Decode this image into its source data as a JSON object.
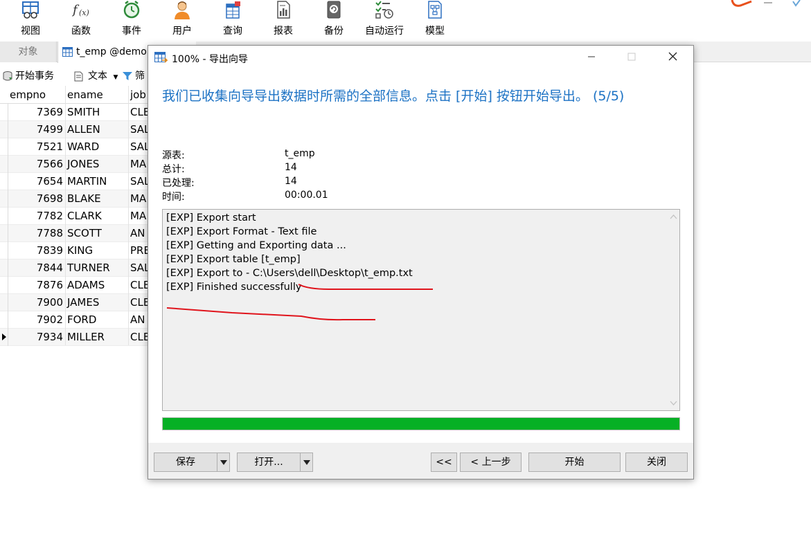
{
  "toolbar": {
    "items": [
      {
        "label": "视图",
        "icon": "view-grid-icon"
      },
      {
        "label": "函数",
        "icon": "function-icon"
      },
      {
        "label": "事件",
        "icon": "alarm-clock-icon"
      },
      {
        "label": "用户",
        "icon": "user-icon"
      },
      {
        "label": "查询",
        "icon": "query-icon"
      },
      {
        "label": "报表",
        "icon": "report-icon"
      },
      {
        "label": "备份",
        "icon": "backup-icon"
      },
      {
        "label": "自动运行",
        "icon": "auto-run-icon"
      },
      {
        "label": "模型",
        "icon": "model-icon"
      }
    ]
  },
  "tabs": {
    "objects_label": "对象",
    "active_label": "t_emp @demo"
  },
  "subbar": {
    "begin_transaction": "开始事务",
    "text": "文本",
    "filter": "筛"
  },
  "grid": {
    "columns": [
      "empno",
      "ename",
      "job"
    ],
    "rows": [
      {
        "empno": "7369",
        "ename": "SMITH",
        "job": "CLE"
      },
      {
        "empno": "7499",
        "ename": "ALLEN",
        "job": "SAL"
      },
      {
        "empno": "7521",
        "ename": "WARD",
        "job": "SAL"
      },
      {
        "empno": "7566",
        "ename": "JONES",
        "job": "MA"
      },
      {
        "empno": "7654",
        "ename": "MARTIN",
        "job": "SAL"
      },
      {
        "empno": "7698",
        "ename": "BLAKE",
        "job": "MA"
      },
      {
        "empno": "7782",
        "ename": "CLARK",
        "job": "MA"
      },
      {
        "empno": "7788",
        "ename": "SCOTT",
        "job": "AN"
      },
      {
        "empno": "7839",
        "ename": "KING",
        "job": "PRE"
      },
      {
        "empno": "7844",
        "ename": "TURNER",
        "job": "SAL"
      },
      {
        "empno": "7876",
        "ename": "ADAMS",
        "job": "CLE"
      },
      {
        "empno": "7900",
        "ename": "JAMES",
        "job": "CLE"
      },
      {
        "empno": "7902",
        "ename": "FORD",
        "job": "AN"
      },
      {
        "empno": "7934",
        "ename": "MILLER",
        "job": "CLE"
      }
    ]
  },
  "dialog": {
    "title": "100% - 导出向导",
    "heading": "我们已收集向导导出数据时所需的全部信息。点击 [开始] 按钮开始导出。 (5/5)",
    "info": [
      {
        "label": "源表:",
        "value": "t_emp"
      },
      {
        "label": "总计:",
        "value": "14"
      },
      {
        "label": "已处理:",
        "value": "14"
      },
      {
        "label": "时间:",
        "value": "00:00.01"
      }
    ],
    "log": [
      "[EXP] Export start",
      "[EXP] Export Format - Text file",
      "[EXP] Getting and Exporting data ...",
      "[EXP] Export table [t_emp]",
      "[EXP] Export to - C:\\Users\\dell\\Desktop\\t_emp.txt",
      "[EXP] Finished successfully"
    ],
    "progress": 1.0,
    "progress_color": "#06b025",
    "heading_color": "#1c72c4",
    "annotation_color": "#e0141c",
    "buttons": {
      "save": "保存",
      "open": "打开...",
      "first": "<<",
      "back": "< 上一步",
      "start": "开始",
      "close": "关闭"
    }
  }
}
